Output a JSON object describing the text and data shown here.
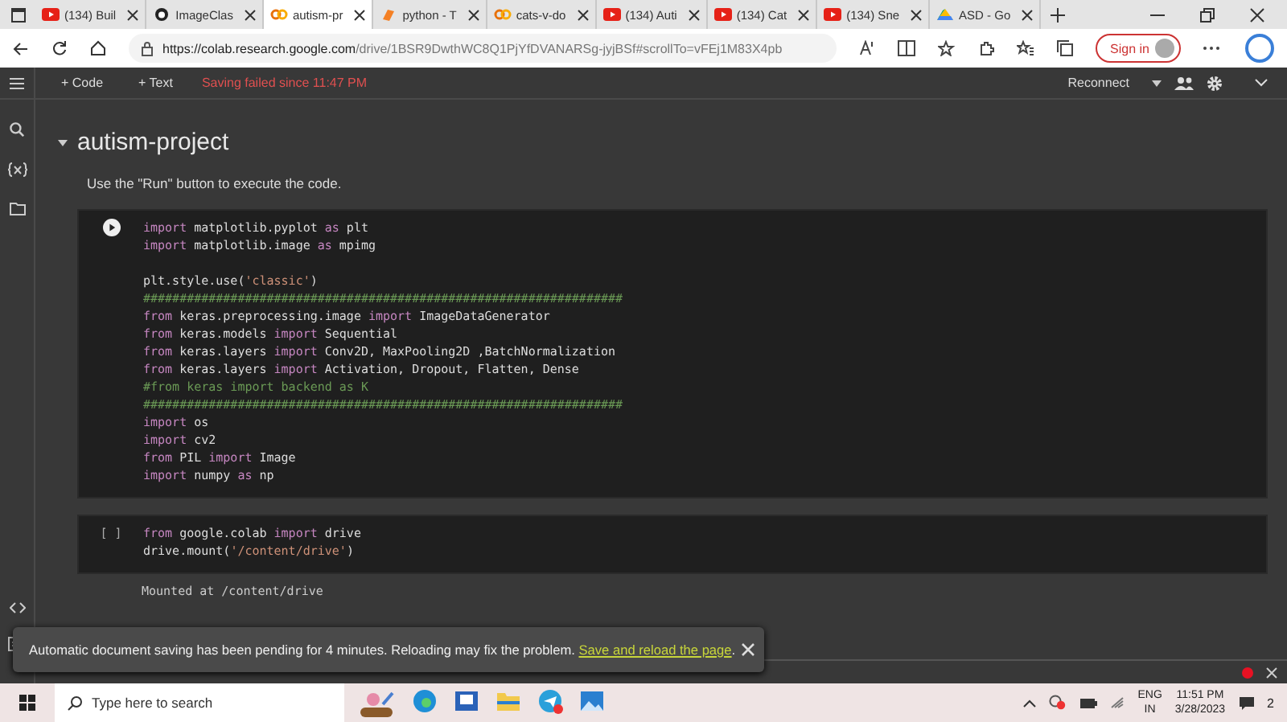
{
  "browser": {
    "tabs": [
      {
        "label": "(134) Buil",
        "kind": "video",
        "selected": false
      },
      {
        "label": "ImageClas",
        "kind": "repo",
        "selected": false
      },
      {
        "label": "autism-pr",
        "kind": "notebook",
        "selected": true
      },
      {
        "label": "python - T",
        "kind": "forum",
        "selected": false
      },
      {
        "label": "cats-v-do",
        "kind": "notebook",
        "selected": false
      },
      {
        "label": "(134) Auti",
        "kind": "video",
        "selected": false
      },
      {
        "label": "(134) Cat",
        "kind": "video",
        "selected": false
      },
      {
        "label": "(134) Sne",
        "kind": "video",
        "selected": false
      },
      {
        "label": "ASD - Go",
        "kind": "drive",
        "selected": false
      }
    ],
    "url_host": "https://colab.research.google.com",
    "url_path": "/drive/1BSR9DwthWC8Q1PjYfDVANARSg-jyjBSf#scrollTo=vFEj1M83X4pb",
    "sign_in": "Sign in"
  },
  "toolbar": {
    "add_code": "+ Code",
    "add_text": "+ Text",
    "save_status": "Saving failed since 11:47 PM",
    "connect": "Reconnect"
  },
  "notebook": {
    "heading": "autism-project",
    "intro": "Use the \"Run\" button to execute the code.",
    "cells": [
      {
        "kind": "play",
        "lines": [
          {
            "blank_before": false,
            "tokens": [
              {
                "text": "import",
                "kind": "keyword"
              },
              {
                "text": " matplotlib.pyplot ",
                "kind": "plain"
              },
              {
                "text": "as",
                "kind": "keyword"
              },
              {
                "text": " plt",
                "kind": "plain"
              }
            ]
          },
          {
            "blank_before": false,
            "tokens": [
              {
                "text": "import",
                "kind": "keyword"
              },
              {
                "text": " matplotlib.image ",
                "kind": "plain"
              },
              {
                "text": "as",
                "kind": "keyword"
              },
              {
                "text": " mpimg",
                "kind": "plain"
              }
            ]
          },
          {
            "blank_before": true,
            "tokens": [
              {
                "text": "plt.style.use(",
                "kind": "plain"
              },
              {
                "text": "'classic'",
                "kind": "string"
              },
              {
                "text": ")",
                "kind": "plain"
              }
            ]
          },
          {
            "blank_before": false,
            "tokens": [
              {
                "text": "##################################################################",
                "kind": "comment"
              }
            ]
          },
          {
            "blank_before": false,
            "tokens": [
              {
                "text": "from",
                "kind": "keyword"
              },
              {
                "text": " keras.preprocessing.image ",
                "kind": "plain"
              },
              {
                "text": "import",
                "kind": "keyword"
              },
              {
                "text": " ImageDataGenerator",
                "kind": "plain"
              }
            ]
          },
          {
            "blank_before": false,
            "tokens": [
              {
                "text": "from",
                "kind": "keyword"
              },
              {
                "text": " keras.models ",
                "kind": "plain"
              },
              {
                "text": "import",
                "kind": "keyword"
              },
              {
                "text": " Sequential",
                "kind": "plain"
              }
            ]
          },
          {
            "blank_before": false,
            "tokens": [
              {
                "text": "from",
                "kind": "keyword"
              },
              {
                "text": " keras.layers ",
                "kind": "plain"
              },
              {
                "text": "import",
                "kind": "keyword"
              },
              {
                "text": " Conv2D, MaxPooling2D ,BatchNormalization",
                "kind": "plain"
              }
            ]
          },
          {
            "blank_before": false,
            "tokens": [
              {
                "text": "from",
                "kind": "keyword"
              },
              {
                "text": " keras.layers ",
                "kind": "plain"
              },
              {
                "text": "import",
                "kind": "keyword"
              },
              {
                "text": " Activation, Dropout, Flatten, Dense",
                "kind": "plain"
              }
            ]
          },
          {
            "blank_before": false,
            "tokens": [
              {
                "text": "#from keras import backend as K",
                "kind": "comment"
              }
            ]
          },
          {
            "blank_before": false,
            "tokens": [
              {
                "text": "##################################################################",
                "kind": "comment"
              }
            ]
          },
          {
            "blank_before": false,
            "tokens": [
              {
                "text": "import",
                "kind": "keyword"
              },
              {
                "text": " os",
                "kind": "plain"
              }
            ]
          },
          {
            "blank_before": false,
            "tokens": [
              {
                "text": "import",
                "kind": "keyword"
              },
              {
                "text": " cv2",
                "kind": "plain"
              }
            ]
          },
          {
            "blank_before": false,
            "tokens": [
              {
                "text": "from",
                "kind": "keyword"
              },
              {
                "text": " PIL ",
                "kind": "plain"
              },
              {
                "text": "import",
                "kind": "keyword"
              },
              {
                "text": " Image",
                "kind": "plain"
              }
            ]
          },
          {
            "blank_before": false,
            "tokens": [
              {
                "text": "import",
                "kind": "keyword"
              },
              {
                "text": " numpy ",
                "kind": "plain"
              },
              {
                "text": "as",
                "kind": "keyword"
              },
              {
                "text": " np",
                "kind": "plain"
              }
            ]
          }
        ]
      },
      {
        "run_label": "[ ]",
        "kind": "bracket",
        "lines": [
          {
            "blank_before": false,
            "tokens": [
              {
                "text": "from",
                "kind": "keyword"
              },
              {
                "text": " google.colab ",
                "kind": "plain"
              },
              {
                "text": "import",
                "kind": "keyword"
              },
              {
                "text": " drive",
                "kind": "plain"
              }
            ]
          },
          {
            "blank_before": false,
            "tokens": [
              {
                "text": "drive.mount(",
                "kind": "plain"
              },
              {
                "text": "'/content/drive'",
                "kind": "string"
              },
              {
                "text": ")",
                "kind": "plain"
              }
            ]
          }
        ],
        "output": "Mounted at /content/drive"
      }
    ]
  },
  "toast": {
    "message": "Automatic document saving has been pending for 4 minutes. Reloading may fix the problem.",
    "link": "Save and reload the page",
    "after": "."
  },
  "taskbar": {
    "search_placeholder": "Type here to search",
    "lang": "ENG",
    "region": "IN",
    "time": "11:51 PM",
    "date": "3/28/2023",
    "notifications": "2"
  }
}
